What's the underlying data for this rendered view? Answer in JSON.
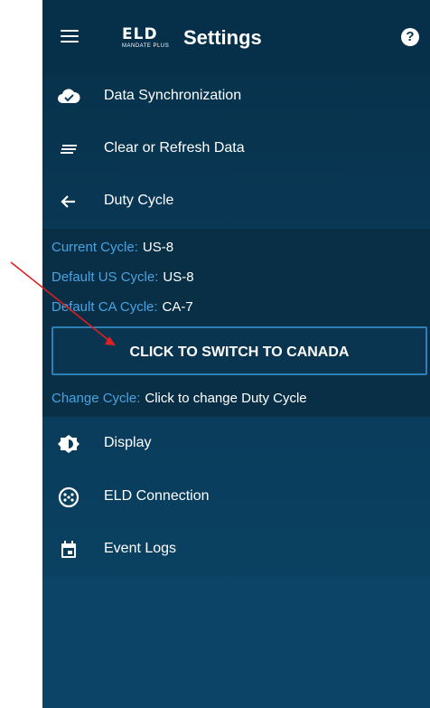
{
  "app": {
    "title": "Settings",
    "logo_main": "ELD",
    "logo_sub": "MANDATE PLUS"
  },
  "menu": {
    "items": [
      {
        "label": "Data Synchronization",
        "icon": "cloud-check-icon"
      },
      {
        "label": "Clear or Refresh Data",
        "icon": "lines-icon"
      },
      {
        "label": "Duty Cycle",
        "icon": "arrow-left-icon"
      }
    ],
    "items_after": [
      {
        "label": "Display",
        "icon": "brightness-icon"
      },
      {
        "label": "ELD Connection",
        "icon": "connector-icon"
      },
      {
        "label": "Event Logs",
        "icon": "calendar-icon"
      }
    ]
  },
  "duty_cycle": {
    "current_label": "Current Cycle:",
    "current_value": "US-8",
    "default_us_label": "Default US Cycle:",
    "default_us_value": "US-8",
    "default_ca_label": "Default CA Cycle:",
    "default_ca_value": "CA-7",
    "switch_button": "CLICK TO SWITCH TO CANADA",
    "change_label": "Change Cycle:",
    "change_value": "Click to change Duty Cycle"
  },
  "colors": {
    "background": "#0a3a58",
    "panel": "#092f47",
    "accent": "#4aa3e0",
    "annotation": "#e01f1f"
  }
}
